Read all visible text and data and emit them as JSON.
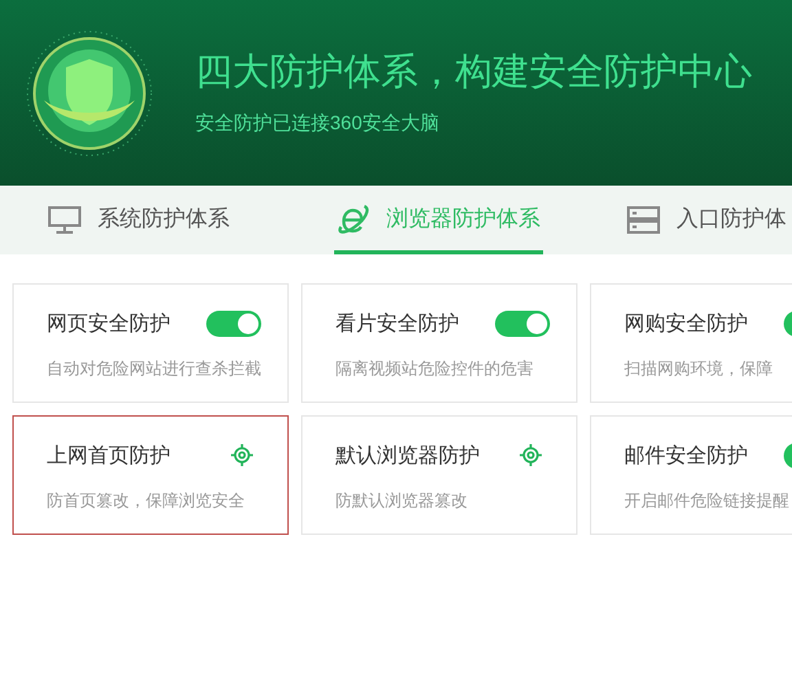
{
  "header": {
    "title": "四大防护体系，构建安全防护中心",
    "subtitle": "安全防护已连接360安全大脑"
  },
  "tabs": [
    {
      "label": "系统防护体系",
      "kind": "monitor",
      "selected": false
    },
    {
      "label": "浏览器防护体系",
      "kind": "browser",
      "selected": true
    },
    {
      "label": "入口防护体",
      "kind": "server",
      "selected": false
    }
  ],
  "cards": [
    {
      "title": "网页安全防护",
      "description": "自动对危险网站进行查杀拦截",
      "kind": "toggle",
      "on": true,
      "highlighted": false
    },
    {
      "title": "看片安全防护",
      "description": "隔离视频站危险控件的危害",
      "kind": "toggle",
      "on": true,
      "highlighted": false
    },
    {
      "title": "网购安全防护",
      "description": "扫描网购环境，保障",
      "kind": "toggle",
      "on": true,
      "highlighted": false
    },
    {
      "title": "上网首页防护",
      "description": "防首页篡改，保障浏览安全",
      "kind": "settings",
      "highlighted": true
    },
    {
      "title": "默认浏览器防护",
      "description": "防默认浏览器篡改",
      "kind": "settings",
      "highlighted": false
    },
    {
      "title": "邮件安全防护",
      "description": "开启邮件危险链接提醒",
      "kind": "toggle",
      "on": true,
      "highlighted": false
    }
  ]
}
